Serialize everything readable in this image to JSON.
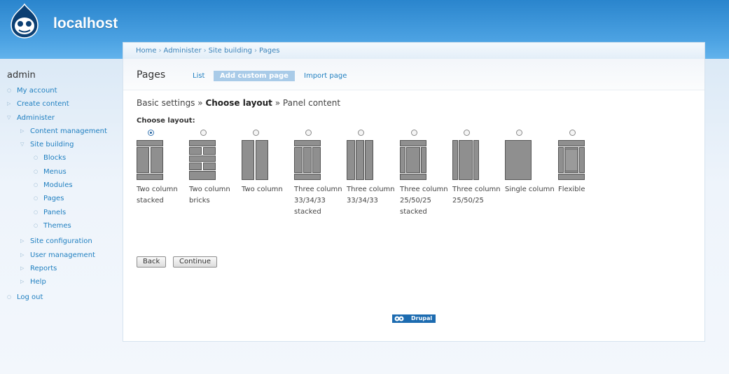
{
  "header": {
    "site_name": "localhost"
  },
  "breadcrumb": [
    "Home",
    "Administer",
    "Site building",
    "Pages"
  ],
  "page": {
    "title": "Pages",
    "tabs": [
      {
        "label": "List",
        "active": false
      },
      {
        "label": "Add custom page",
        "active": true
      },
      {
        "label": "Import page",
        "active": false
      }
    ],
    "steps": {
      "step1": "Basic settings",
      "sep": "»",
      "step2": "Choose layout",
      "step3": "Panel content"
    },
    "choose_label": "Choose layout:",
    "layouts": [
      {
        "name": "Two column stacked",
        "line1": "Two column",
        "line2": "stacked",
        "line3": "",
        "checked": true
      },
      {
        "name": "Two column bricks",
        "line1": "Two column",
        "line2": "bricks",
        "line3": "",
        "checked": false
      },
      {
        "name": "Two column",
        "line1": "Two column",
        "line2": "",
        "line3": "",
        "checked": false
      },
      {
        "name": "Three column 33/34/33 stacked",
        "line1": "Three column",
        "line2": "33/34/33",
        "line3": "stacked",
        "checked": false
      },
      {
        "name": "Three column 33/34/33",
        "line1": "Three column",
        "line2": "33/34/33",
        "line3": "",
        "checked": false
      },
      {
        "name": "Three column 25/50/25 stacked",
        "line1": "Three column",
        "line2": "25/50/25",
        "line3": "stacked",
        "checked": false
      },
      {
        "name": "Three column 25/50/25",
        "line1": "Three column",
        "line2": "25/50/25",
        "line3": "",
        "checked": false
      },
      {
        "name": "Single column",
        "line1": "Single column",
        "line2": "",
        "line3": "",
        "checked": false
      },
      {
        "name": "Flexible",
        "line1": "Flexible",
        "line2": "",
        "line3": "",
        "checked": false
      }
    ],
    "buttons": {
      "back": "Back",
      "continue": "Continue"
    },
    "powered_by": "Drupal"
  },
  "sidebar": {
    "user": "admin",
    "items": [
      {
        "label": "My account",
        "level": 0,
        "state": "leaf"
      },
      {
        "label": "Create content",
        "level": 0,
        "state": "collapsed"
      },
      {
        "label": "Administer",
        "level": 0,
        "state": "expanded"
      },
      {
        "label": "Content management",
        "level": 1,
        "state": "collapsed"
      },
      {
        "label": "Site building",
        "level": 1,
        "state": "expanded"
      },
      {
        "label": "Blocks",
        "level": 2,
        "state": "leaf"
      },
      {
        "label": "Menus",
        "level": 2,
        "state": "leaf"
      },
      {
        "label": "Modules",
        "level": 2,
        "state": "leaf"
      },
      {
        "label": "Pages",
        "level": 2,
        "state": "leaf"
      },
      {
        "label": "Panels",
        "level": 2,
        "state": "leaf"
      },
      {
        "label": "Themes",
        "level": 2,
        "state": "leaf"
      },
      {
        "label": "Site configuration",
        "level": 1,
        "state": "collapsed"
      },
      {
        "label": "User management",
        "level": 1,
        "state": "collapsed"
      },
      {
        "label": "Reports",
        "level": 1,
        "state": "collapsed"
      },
      {
        "label": "Help",
        "level": 1,
        "state": "collapsed"
      },
      {
        "label": "Log out",
        "level": 0,
        "state": "leaf"
      }
    ]
  },
  "colors": {
    "link": "#1f7fc0",
    "header_top": "#2a85cd",
    "active_tab": "#a9cbe8",
    "layout_fill": "#8f8f8f"
  }
}
